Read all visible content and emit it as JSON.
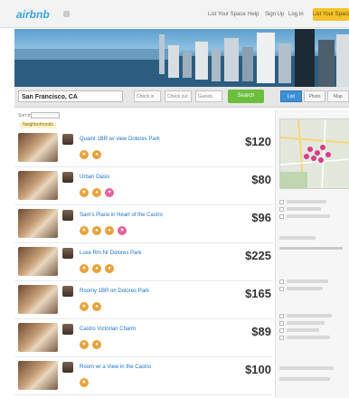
{
  "nav": {
    "logo": "airbnb",
    "links": [
      "List Your Space",
      "Help",
      "Sign Up",
      "Log In"
    ],
    "cta": "List Your Space"
  },
  "search": {
    "location": "San Francisco, CA",
    "checkin_placeholder": "Check in",
    "checkout_placeholder": "Check out",
    "guests": "Guests",
    "search_label": "Search",
    "view_tabs": [
      "List",
      "Photo",
      "Map"
    ]
  },
  "sort": {
    "label": "Sort by",
    "filter_chip": "Neighborhoods"
  },
  "listings": [
    {
      "title": "Quaint 1BR w/ view Dolores Park",
      "price": "$120"
    },
    {
      "title": "Urban Oasis",
      "price": "$80"
    },
    {
      "title": "Sam's Place in Heart of the Castro",
      "price": "$96"
    },
    {
      "title": "Luxe Rm Nr Dolores Park",
      "price": "$225"
    },
    {
      "title": "Roomy 1BR on Dolores Park",
      "price": "$165"
    },
    {
      "title": "Castro Victorian Charm",
      "price": "$89"
    },
    {
      "title": "Room w/ a View in the Castro",
      "price": "$100"
    }
  ],
  "colors": {
    "accent_blue": "#3d8fd6",
    "search_green": "#6cbf3c",
    "cta_yellow": "#f3c22c",
    "map_pin": "#d63c8b",
    "badge_orange": "#e9a23b",
    "badge_pink": "#e8609e"
  }
}
